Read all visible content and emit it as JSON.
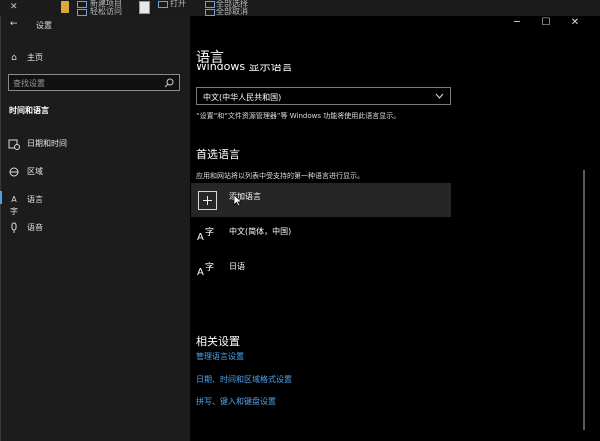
{
  "background_window": {
    "items": [
      "新建项目",
      "轻松访问",
      "打开",
      "全部选择",
      "全部取消"
    ]
  },
  "window": {
    "title": "设置",
    "controls": {
      "minimize": "─",
      "maximize": "☐",
      "close": "✕"
    }
  },
  "sidebar": {
    "home_label": "主页",
    "search_placeholder": "查找设置",
    "section_title": "时间和语言",
    "items": [
      {
        "label": "日期和时间",
        "icon": "calendar-clock-icon"
      },
      {
        "label": "区域",
        "icon": "globe-region-icon"
      },
      {
        "label": "语言",
        "icon": "language-icon",
        "selected": true
      },
      {
        "label": "语音",
        "icon": "microphone-icon"
      }
    ]
  },
  "main": {
    "page_title": "语言",
    "display_language_heading": "Windows 显示语言",
    "display_language_value": "中文(中华人民共和国)",
    "display_language_note": "“设置”和“文件资源管理器”等 Windows 功能将使用此语言显示。",
    "preferred_heading": "首选语言",
    "preferred_desc": "应用和网站将以列表中受支持的第一种语言进行显示。",
    "add_language_label": "添加语言",
    "languages": [
      {
        "name": "中文(简体，中国)"
      },
      {
        "name": "日语"
      }
    ],
    "related_heading": "相关设置",
    "related_links": [
      "管理语言设置",
      "日期、时间和区域格式设置",
      "拼写、键入和键盘设置"
    ]
  },
  "colors": {
    "accent": "#4fa3ea",
    "sidebar_bg": "#1c1c1c",
    "content_bg": "#000000",
    "hover_row": "#262626"
  }
}
